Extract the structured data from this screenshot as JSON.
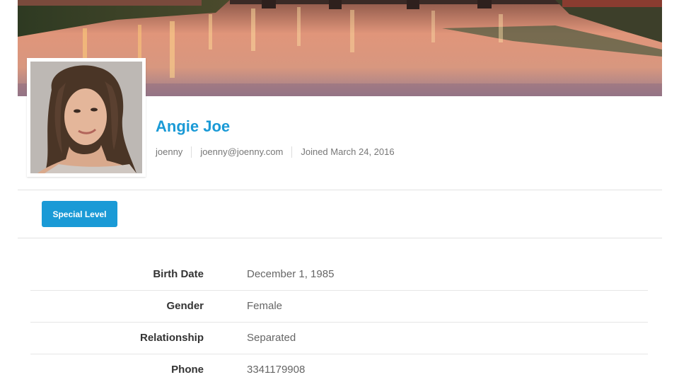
{
  "profile": {
    "name": "Angie Joe",
    "username": "joenny",
    "email": "joenny@joenny.com",
    "joined": "Joined March 24, 2016"
  },
  "level_button": {
    "label": "Special Level"
  },
  "details": [
    {
      "label": "Birth Date",
      "value": "December 1, 1985"
    },
    {
      "label": "Gender",
      "value": "Female"
    },
    {
      "label": "Relationship",
      "value": "Separated"
    },
    {
      "label": "Phone",
      "value": "3341179908"
    }
  ],
  "colors": {
    "accent": "#1a9ad6",
    "label_text": "#333333",
    "value_text": "#666666",
    "divider": "#e2e2e2"
  }
}
